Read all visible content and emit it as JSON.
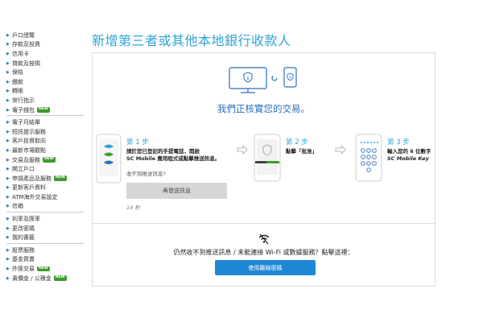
{
  "page_title": "新增第三者或其他本地銀行收款人",
  "sidebar": {
    "groups": [
      {
        "items": [
          {
            "label": "戶口總覽"
          },
          {
            "label": "存款及投資"
          },
          {
            "label": "信用卡"
          },
          {
            "label": "貸款及按揭"
          },
          {
            "label": "保險"
          },
          {
            "label": "繳款"
          },
          {
            "label": "轉賬"
          },
          {
            "label": "常行指示"
          },
          {
            "label": "電子錢包",
            "badge": "NEW"
          }
        ]
      },
      {
        "items": [
          {
            "label": "電子月結單"
          },
          {
            "label": "短訊提示服務"
          },
          {
            "label": "客戶投資取向"
          },
          {
            "label": "最新市場觀點"
          },
          {
            "label": "交易及服務",
            "badge": "NEW"
          },
          {
            "label": "開立戶口"
          },
          {
            "label": "申請產品及服務",
            "badge": "NEW"
          },
          {
            "label": "更新客戶資料"
          },
          {
            "label": "ATM海外交易設定"
          },
          {
            "label": "信箱"
          }
        ]
      },
      {
        "items": [
          {
            "label": "利率及匯率"
          },
          {
            "label": "更改密碼"
          },
          {
            "label": "我的書籤"
          }
        ]
      },
      {
        "items": [
          {
            "label": "股票服務"
          },
          {
            "label": "基金買賣"
          },
          {
            "label": "外匯交易",
            "badge": "NEW"
          },
          {
            "label": "貴價金 / 公積金",
            "badge": "NEW"
          }
        ]
      }
    ]
  },
  "main": {
    "verifying_text": "我們正核實您的交易。",
    "step1": {
      "label": "第 1 步",
      "text_line1": "請於您已登記的手提電話，開啟",
      "text_line2": "SC Mobile 應用程式或點擊推送訊息。",
      "not_received": "收不到推送訊息?",
      "resend_button": "再發送訊息",
      "timer": "14 秒"
    },
    "step2": {
      "label": "第 2 步",
      "text": "點擊「批准」"
    },
    "step3": {
      "label": "第 3 步",
      "text": "輸入您的 6 位數字",
      "text_line2": "SC Mobile Key"
    },
    "help_text": "仍然收不到推送訊息 / 未能連接 Wi-Fi 或數據服務？點擊這裡：",
    "network_button": "使用離線密碼"
  },
  "colors": {
    "accent": "#2fa3d9",
    "primary_button": "#1f88d6",
    "badge": "#3f9b2e"
  }
}
